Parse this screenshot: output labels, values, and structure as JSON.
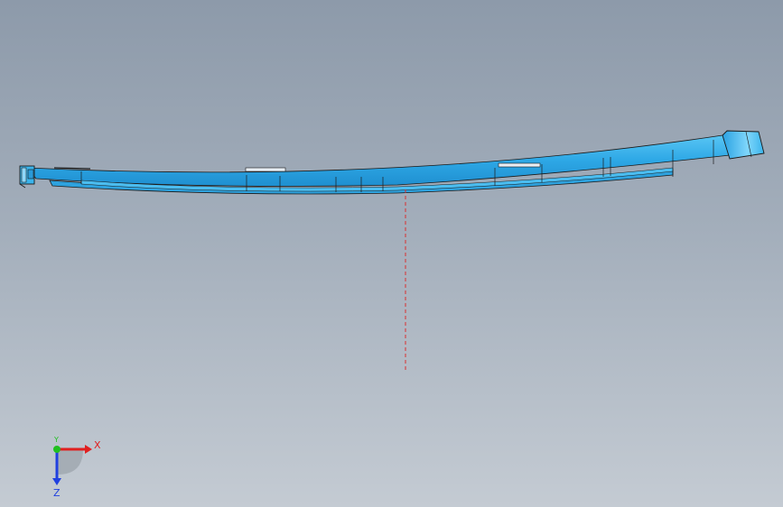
{
  "viewport": {
    "background_top": "#8d9aaa",
    "background_bottom": "#c4cbd3"
  },
  "model": {
    "part_color": "#3ab4ec",
    "part_edge_color": "#1a1a1a",
    "centerline_color": "#d93030"
  },
  "triad": {
    "x_label": "X",
    "z_label": "Z",
    "y_label": "Y",
    "x_color": "#e02020",
    "y_color": "#20c020",
    "z_color": "#2040e0"
  }
}
